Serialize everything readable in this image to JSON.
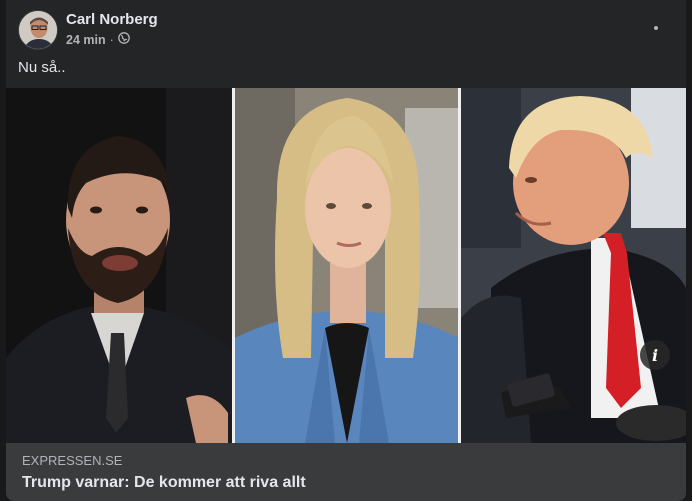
{
  "post": {
    "author": "Carl Norberg",
    "time": "24 min",
    "separator": "·",
    "privacy_icon": "globe-icon",
    "more_icon": "more-horizontal-icon",
    "text": "Nu så.."
  },
  "link_preview": {
    "domain": "EXPRESSEN.SE",
    "headline": "Trump varnar: De kommer att riva allt",
    "info_icon_label": "i"
  },
  "colors": {
    "background": "#18191a",
    "card": "#242526",
    "link_bar": "#3a3b3c",
    "primary_text": "#e4e6eb",
    "secondary_text": "#b0b3b8"
  }
}
